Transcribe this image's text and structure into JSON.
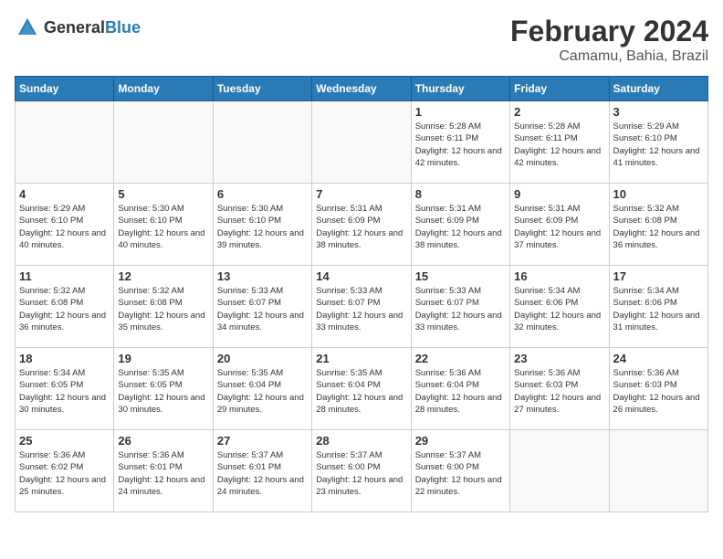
{
  "header": {
    "logo_general": "General",
    "logo_blue": "Blue",
    "month": "February 2024",
    "location": "Camamu, Bahia, Brazil"
  },
  "weekdays": [
    "Sunday",
    "Monday",
    "Tuesday",
    "Wednesday",
    "Thursday",
    "Friday",
    "Saturday"
  ],
  "weeks": [
    [
      {
        "day": "",
        "info": ""
      },
      {
        "day": "",
        "info": ""
      },
      {
        "day": "",
        "info": ""
      },
      {
        "day": "",
        "info": ""
      },
      {
        "day": "1",
        "info": "Sunrise: 5:28 AM\nSunset: 6:11 PM\nDaylight: 12 hours\nand 42 minutes."
      },
      {
        "day": "2",
        "info": "Sunrise: 5:28 AM\nSunset: 6:11 PM\nDaylight: 12 hours\nand 42 minutes."
      },
      {
        "day": "3",
        "info": "Sunrise: 5:29 AM\nSunset: 6:10 PM\nDaylight: 12 hours\nand 41 minutes."
      }
    ],
    [
      {
        "day": "4",
        "info": "Sunrise: 5:29 AM\nSunset: 6:10 PM\nDaylight: 12 hours\nand 40 minutes."
      },
      {
        "day": "5",
        "info": "Sunrise: 5:30 AM\nSunset: 6:10 PM\nDaylight: 12 hours\nand 40 minutes."
      },
      {
        "day": "6",
        "info": "Sunrise: 5:30 AM\nSunset: 6:10 PM\nDaylight: 12 hours\nand 39 minutes."
      },
      {
        "day": "7",
        "info": "Sunrise: 5:31 AM\nSunset: 6:09 PM\nDaylight: 12 hours\nand 38 minutes."
      },
      {
        "day": "8",
        "info": "Sunrise: 5:31 AM\nSunset: 6:09 PM\nDaylight: 12 hours\nand 38 minutes."
      },
      {
        "day": "9",
        "info": "Sunrise: 5:31 AM\nSunset: 6:09 PM\nDaylight: 12 hours\nand 37 minutes."
      },
      {
        "day": "10",
        "info": "Sunrise: 5:32 AM\nSunset: 6:08 PM\nDaylight: 12 hours\nand 36 minutes."
      }
    ],
    [
      {
        "day": "11",
        "info": "Sunrise: 5:32 AM\nSunset: 6:08 PM\nDaylight: 12 hours\nand 36 minutes."
      },
      {
        "day": "12",
        "info": "Sunrise: 5:32 AM\nSunset: 6:08 PM\nDaylight: 12 hours\nand 35 minutes."
      },
      {
        "day": "13",
        "info": "Sunrise: 5:33 AM\nSunset: 6:07 PM\nDaylight: 12 hours\nand 34 minutes."
      },
      {
        "day": "14",
        "info": "Sunrise: 5:33 AM\nSunset: 6:07 PM\nDaylight: 12 hours\nand 33 minutes."
      },
      {
        "day": "15",
        "info": "Sunrise: 5:33 AM\nSunset: 6:07 PM\nDaylight: 12 hours\nand 33 minutes."
      },
      {
        "day": "16",
        "info": "Sunrise: 5:34 AM\nSunset: 6:06 PM\nDaylight: 12 hours\nand 32 minutes."
      },
      {
        "day": "17",
        "info": "Sunrise: 5:34 AM\nSunset: 6:06 PM\nDaylight: 12 hours\nand 31 minutes."
      }
    ],
    [
      {
        "day": "18",
        "info": "Sunrise: 5:34 AM\nSunset: 6:05 PM\nDaylight: 12 hours\nand 30 minutes."
      },
      {
        "day": "19",
        "info": "Sunrise: 5:35 AM\nSunset: 6:05 PM\nDaylight: 12 hours\nand 30 minutes."
      },
      {
        "day": "20",
        "info": "Sunrise: 5:35 AM\nSunset: 6:04 PM\nDaylight: 12 hours\nand 29 minutes."
      },
      {
        "day": "21",
        "info": "Sunrise: 5:35 AM\nSunset: 6:04 PM\nDaylight: 12 hours\nand 28 minutes."
      },
      {
        "day": "22",
        "info": "Sunrise: 5:36 AM\nSunset: 6:04 PM\nDaylight: 12 hours\nand 28 minutes."
      },
      {
        "day": "23",
        "info": "Sunrise: 5:36 AM\nSunset: 6:03 PM\nDaylight: 12 hours\nand 27 minutes."
      },
      {
        "day": "24",
        "info": "Sunrise: 5:36 AM\nSunset: 6:03 PM\nDaylight: 12 hours\nand 26 minutes."
      }
    ],
    [
      {
        "day": "25",
        "info": "Sunrise: 5:36 AM\nSunset: 6:02 PM\nDaylight: 12 hours\nand 25 minutes."
      },
      {
        "day": "26",
        "info": "Sunrise: 5:36 AM\nSunset: 6:01 PM\nDaylight: 12 hours\nand 24 minutes."
      },
      {
        "day": "27",
        "info": "Sunrise: 5:37 AM\nSunset: 6:01 PM\nDaylight: 12 hours\nand 24 minutes."
      },
      {
        "day": "28",
        "info": "Sunrise: 5:37 AM\nSunset: 6:00 PM\nDaylight: 12 hours\nand 23 minutes."
      },
      {
        "day": "29",
        "info": "Sunrise: 5:37 AM\nSunset: 6:00 PM\nDaylight: 12 hours\nand 22 minutes."
      },
      {
        "day": "",
        "info": ""
      },
      {
        "day": "",
        "info": ""
      }
    ]
  ]
}
